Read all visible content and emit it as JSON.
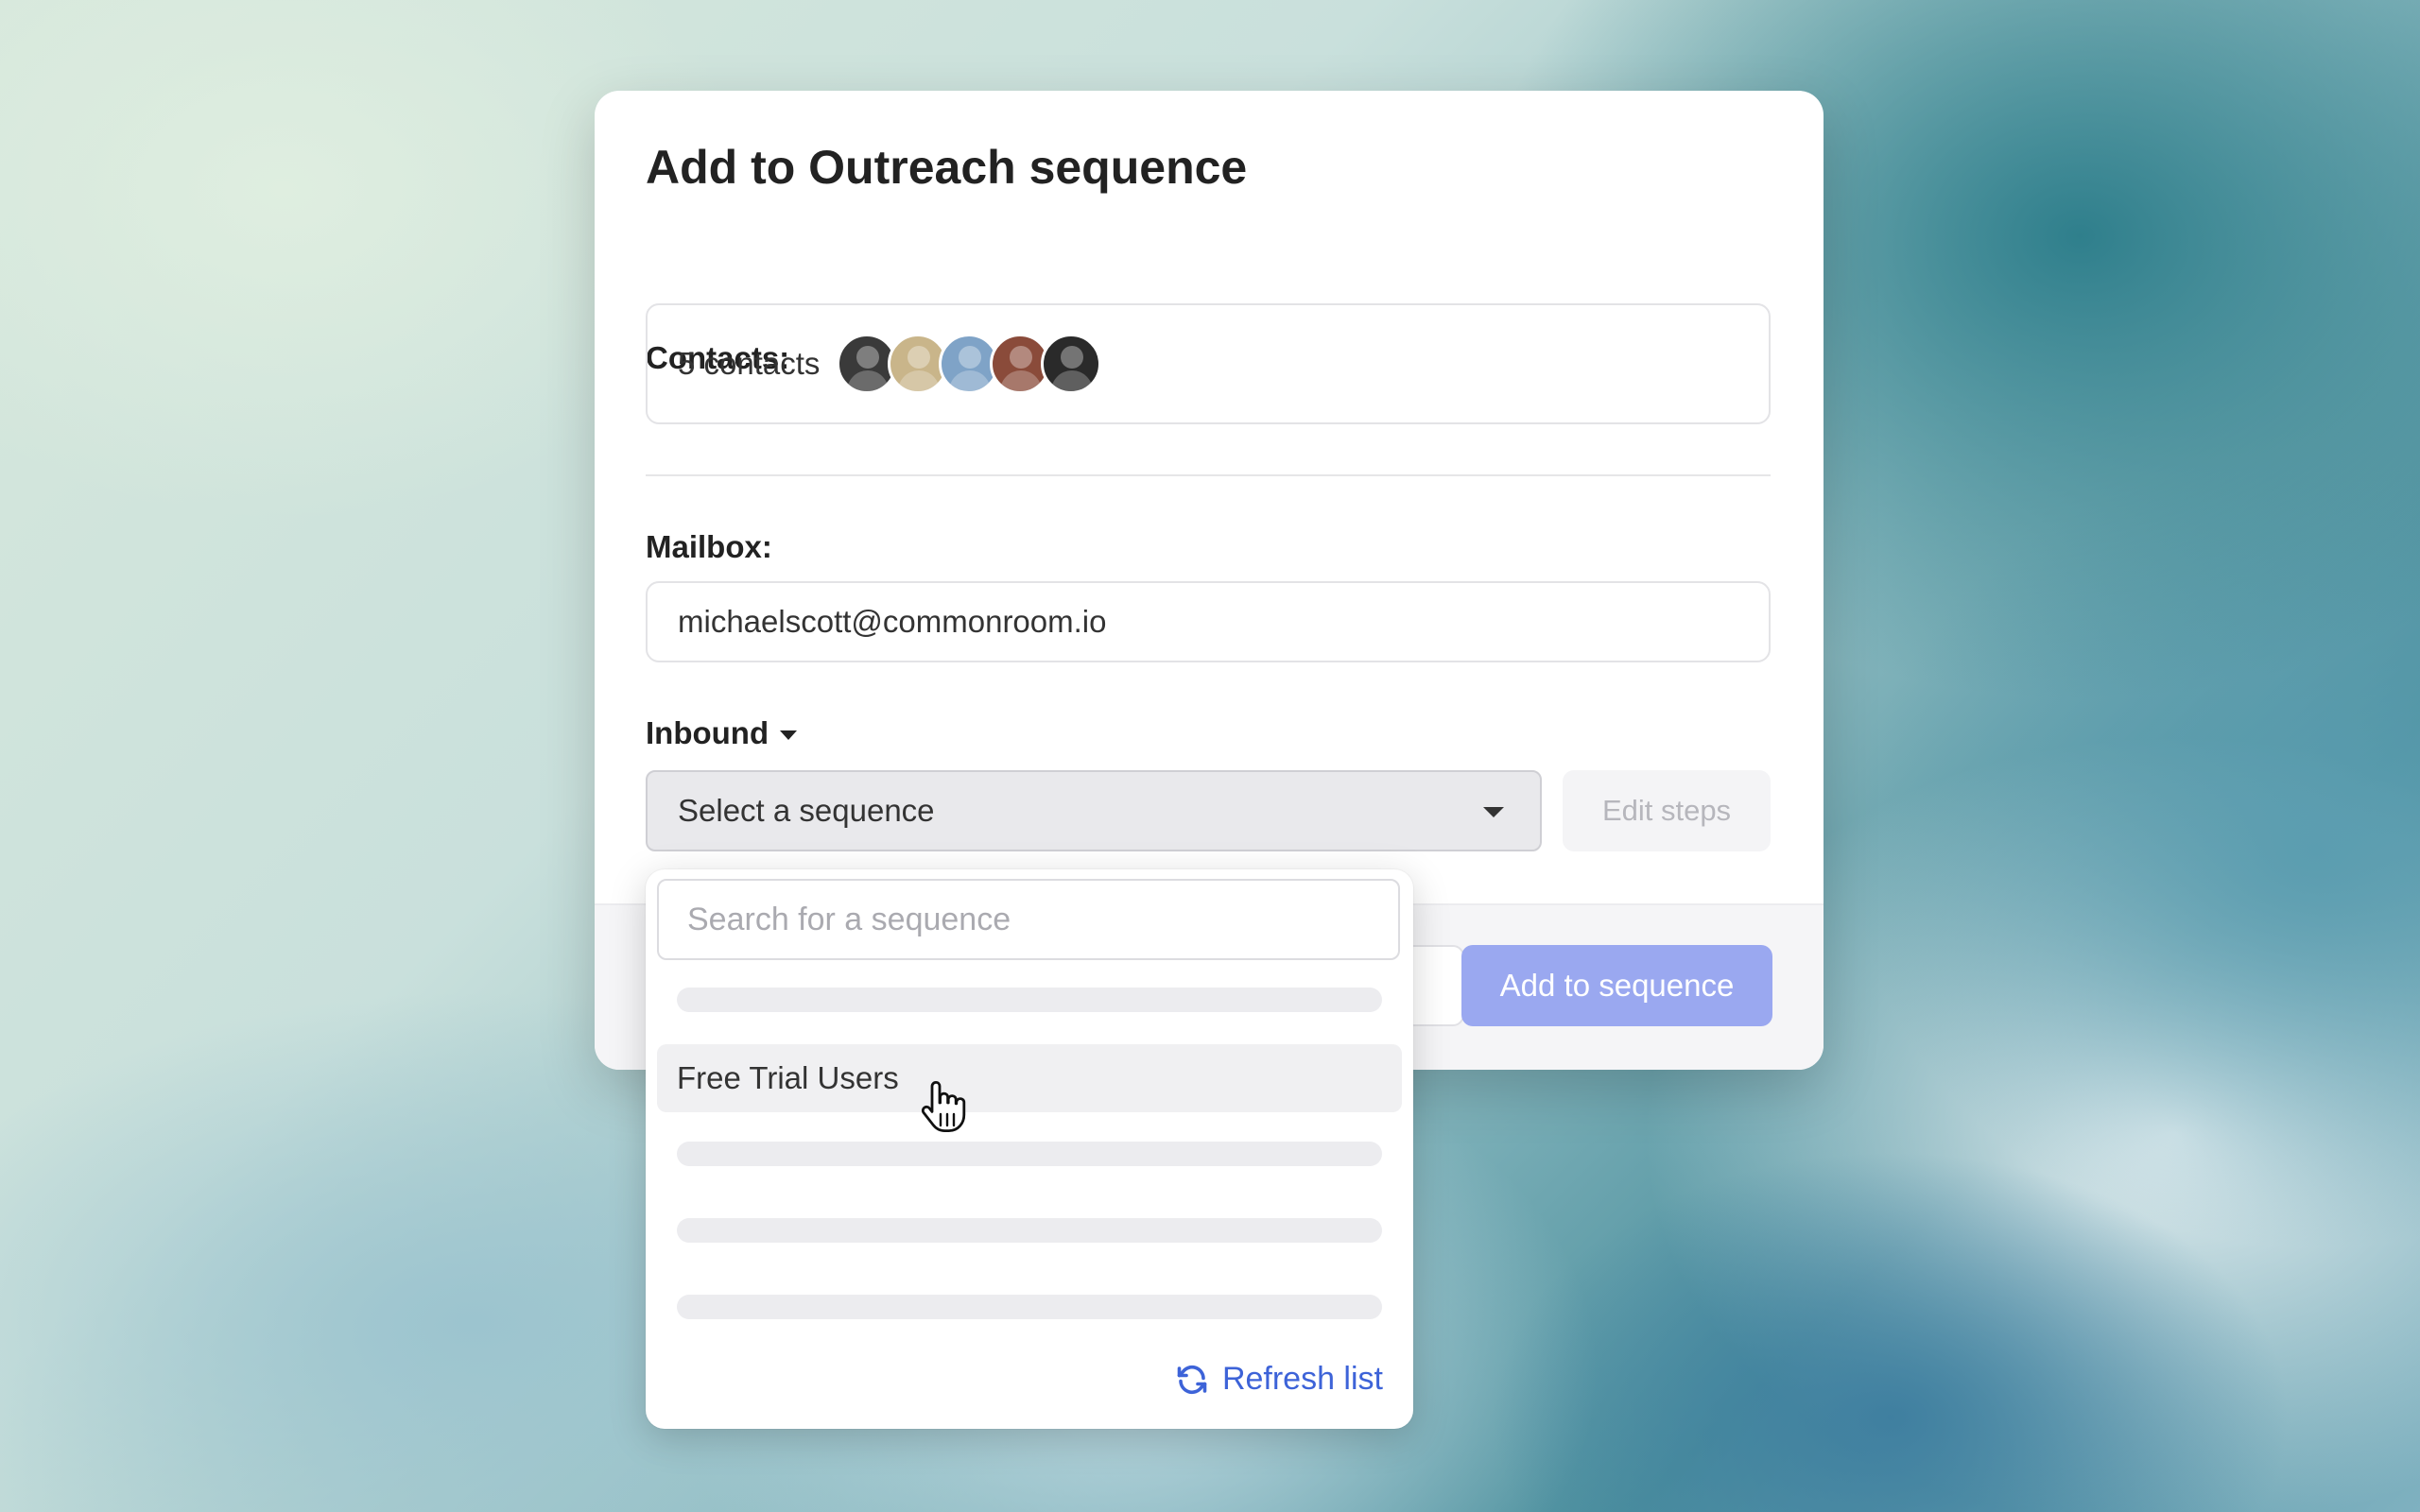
{
  "modal": {
    "title": "Add to Outreach sequence",
    "contacts_label": "Contacts:",
    "contacts_count": "5 contacts",
    "avatars": [
      {
        "color": "#3a3a3a"
      },
      {
        "color": "#c9b58a"
      },
      {
        "color": "#7fa3c7"
      },
      {
        "color": "#8a4b3a"
      },
      {
        "color": "#2a2a2a"
      }
    ],
    "mailbox_label": "Mailbox:",
    "mailbox_value": "michaelscott@commonroom.io",
    "inbound_label": "Inbound",
    "select_placeholder": "Select a sequence",
    "edit_steps_label": "Edit steps",
    "add_button_label": "Add to sequence"
  },
  "dropdown": {
    "search_placeholder": "Search for a sequence",
    "highlighted_item": "Free Trial Users",
    "refresh_label": "Refresh list"
  },
  "colors": {
    "primary_disabled": "#9aa8f0",
    "link": "#3d63d8"
  }
}
